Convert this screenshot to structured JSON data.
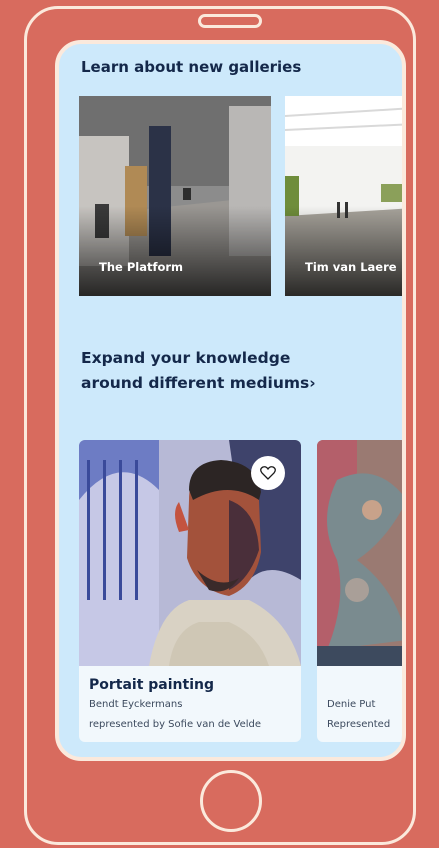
{
  "sections": {
    "galleries_title": "Learn about new galleries",
    "mediums_title": "Expand your knowledge around different mediums›"
  },
  "galleries": [
    {
      "name": "The Platform"
    },
    {
      "name": "Tim van Laere"
    }
  ],
  "artworks": [
    {
      "title": "Portait painting",
      "artist": "Bendt Eyckermans",
      "represented": "represented by Sofie van de Velde",
      "favorite_icon": "heart-icon"
    },
    {
      "title": "",
      "artist": "Denie Put",
      "represented": "Represented"
    }
  ],
  "colors": {
    "background": "#d86b5e",
    "screen": "#cde9fb",
    "text": "#14284a",
    "frame": "#fbe9dc"
  }
}
